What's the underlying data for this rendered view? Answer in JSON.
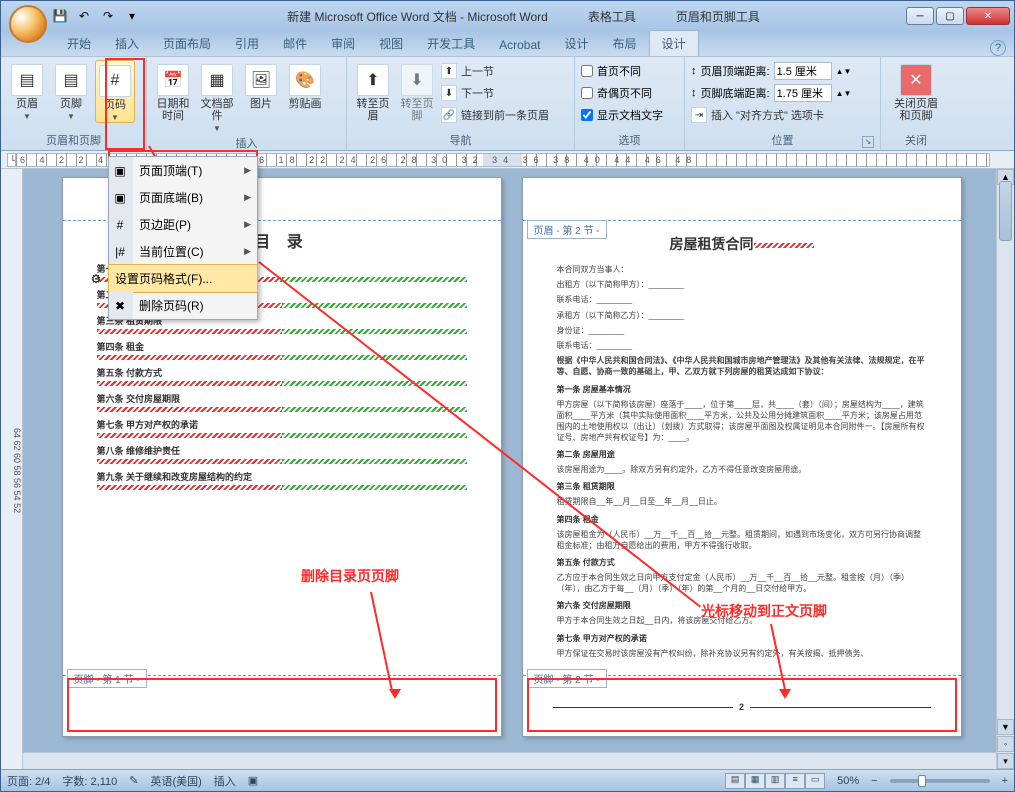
{
  "window": {
    "title_doc": "新建 Microsoft Office Word 文档 - Microsoft Word",
    "title_tool1": "表格工具",
    "title_tool2": "页眉和页脚工具",
    "min": "─",
    "max": "▢",
    "close": "✕"
  },
  "qat": {
    "save": "💾",
    "undo": "↶",
    "redo": "↷",
    "more": "▾"
  },
  "tabs": {
    "start": "开始",
    "insert": "插入",
    "layout": "页面布局",
    "ref": "引用",
    "mail": "邮件",
    "review": "审阅",
    "view": "视图",
    "dev": "开发工具",
    "acrobat": "Acrobat",
    "design1": "设计",
    "layout2": "布局",
    "design2": "设计",
    "help": "?"
  },
  "ribbon": {
    "g1": "页眉和页脚",
    "header": "页眉",
    "footer": "页脚",
    "pagenum": "页码",
    "g2": "插入",
    "datetime": "日期和\n时间",
    "docparts": "文档部件",
    "picture": "图片",
    "clipart": "剪贴画",
    "g3": "导航",
    "goheader": "转至页眉",
    "gofooter": "转至页脚",
    "prev": "上一节",
    "next": "下一节",
    "link": "链接到前一条页眉",
    "g4": "选项",
    "firstdiff": "首页不同",
    "oddeven": "奇偶页不同",
    "showtext": "显示文档文字",
    "g5": "位置",
    "hdrdist": "页眉顶端距离:",
    "hdrdist_v": "1.5 厘米",
    "ftrdist": "页脚底端距离:",
    "ftrdist_v": "1.75 厘米",
    "aligntab": "插入 \"对齐方式\" 选项卡",
    "g6": "关闭",
    "closehf": "关闭页眉\n和页脚"
  },
  "menu": {
    "top": "页面顶端(T)",
    "bottom": "页面底端(B)",
    "margin": "页边距(P)",
    "current": "当前位置(C)",
    "format": "设置页码格式(F)...",
    "remove": "删除页码(R)"
  },
  "ruler": {
    "marks": "6 4 2   2 4 6 8 10 12 14 16 18   22 24 26 28 30 32 34 36 38 40   44 46 48"
  },
  "vruler_text": "64   62   60   58   56   54   52",
  "page1": {
    "toc_title": "目 录",
    "lines": [
      "第一条 房屋基本情况",
      "第二条 房屋用途",
      "第三条 租赁期限",
      "第四条 租金",
      "第五条 付款方式",
      "第六条 交付房屋期限",
      "第七条 甲方对产权的承诺",
      "第八条 维修维护责任",
      "第九条 关于继续和改变房屋结构的约定"
    ],
    "footer_tag": "页脚 - 第 1 节 -"
  },
  "page2": {
    "header_tag": "页眉 - 第 2 节 -",
    "title": "房屋租赁合同",
    "p_intro1": "本合同双方当事人：",
    "p_intro2": "出租方（以下简称甲方）：________",
    "p_intro3": "联系电话：________",
    "p_intro4": "承租方（以下简称乙方）：________",
    "p_intro5": "身份证：________",
    "p_intro6": "联系电话：________",
    "law": "根据《中华人民共和国合同法》、《中华人民共和国城市房地产管理法》及其他有关法律、法规规定，在平等、自愿、协商一致的基础上，甲、乙双方就下列房屋的租赁达成如下协议：",
    "s1": "第一条 房屋基本情况",
    "s1b": "甲方房屋（以下简称该房屋）座落于____，位于第____层，共____（套）（间）；房屋结构为____，建筑面积____平方米（其中实际使用面积____平方米，公共及公用分摊建筑面积____平方米；该房屋占用范围内的土地使用权以（出让）（划拨）方式取得；该房屋平面图及权属证明见本合同附件一。【房屋所有权证号、房地产共有权证号】为：____。",
    "s2": "第二条 房屋用途",
    "s2b": "该房屋用途为____。除双方另有约定外，乙方不得任意改变房屋用途。",
    "s3": "第三条 租赁期限",
    "s3b": "租赁期限自__年__月__日至__年__月__日止。",
    "s4": "第四条 租金",
    "s4b": "该房屋租金为（人民币）__万__千__百__拾__元整。租赁期间，如遇到市场变化，双方可另行协商调整租金标准；由租方自愿给出的费用，甲方不得强行收取。",
    "s5": "第五条 付款方式",
    "s5b": "乙方应于本合同生效之日向甲方支付定金（人民币）__万__千__百__拾__元整。租金按（月）（季）（年），由乙方于每__（月）（季）（年）的第__个月的__日交付给甲方。",
    "s6": "第六条 交付房屋期限",
    "s6b": "甲方于本合同生效之日起__日内，将该房屋交付给乙方。",
    "s7": "第七条 甲方对产权的承诺",
    "s7b": "甲方保证在交易时该房屋没有产权纠纷，除补充协议另有约定外，有关按揭、抵押债务、",
    "footer_tag": "页脚 - 第 2 节 -",
    "pgnum": "2"
  },
  "annotations": {
    "a1": "删除目录页页脚",
    "a2": "光标移动到正文页脚"
  },
  "status": {
    "page": "页面: 2/4",
    "words": "字数: 2,110",
    "lang": "英语(美国)",
    "mode": "插入",
    "zoom": "50%"
  }
}
